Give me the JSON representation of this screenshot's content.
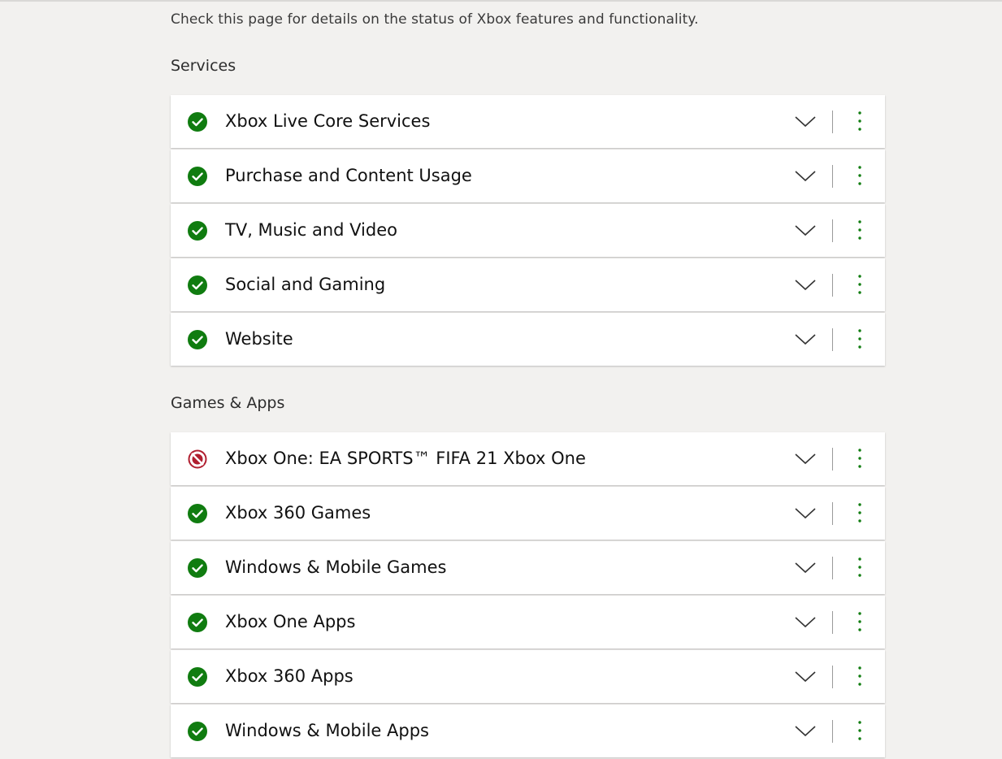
{
  "intro_text": "Check this page for details on the status of Xbox features and functionality.",
  "colors": {
    "ok": "#107c10",
    "blocked": "#b01e2f"
  },
  "sections": [
    {
      "title": "Services",
      "items": [
        {
          "label": "Xbox Live Core Services",
          "status": "ok",
          "icon": "check-circle-icon"
        },
        {
          "label": "Purchase and Content Usage",
          "status": "ok",
          "icon": "check-circle-icon"
        },
        {
          "label": "TV, Music and Video",
          "status": "ok",
          "icon": "check-circle-icon"
        },
        {
          "label": "Social and Gaming",
          "status": "ok",
          "icon": "check-circle-icon"
        },
        {
          "label": "Website",
          "status": "ok",
          "icon": "check-circle-icon"
        }
      ]
    },
    {
      "title": "Games & Apps",
      "items": [
        {
          "label": "Xbox One: EA SPORTS™ FIFA 21 Xbox One",
          "status": "blocked",
          "icon": "blocked-circle-icon"
        },
        {
          "label": "Xbox 360 Games",
          "status": "ok",
          "icon": "check-circle-icon"
        },
        {
          "label": "Windows & Mobile Games",
          "status": "ok",
          "icon": "check-circle-icon"
        },
        {
          "label": "Xbox One Apps",
          "status": "ok",
          "icon": "check-circle-icon"
        },
        {
          "label": "Xbox 360 Apps",
          "status": "ok",
          "icon": "check-circle-icon"
        },
        {
          "label": "Windows & Mobile Apps",
          "status": "ok",
          "icon": "check-circle-icon"
        }
      ]
    }
  ]
}
